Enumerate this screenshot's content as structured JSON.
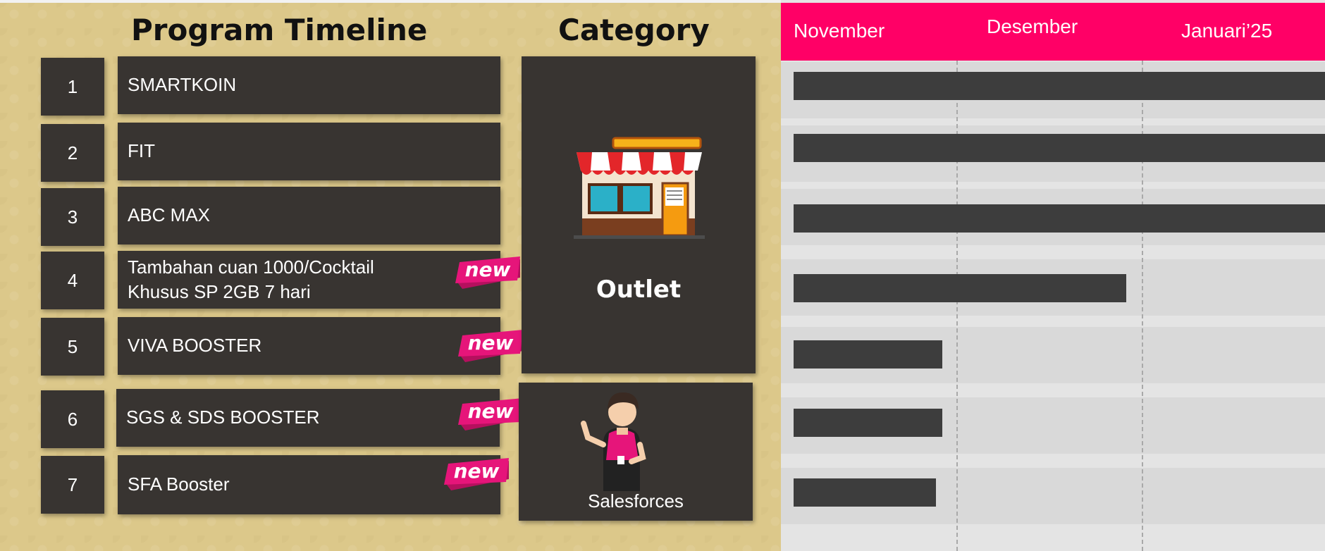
{
  "headings": {
    "program": "Program Timeline",
    "category": "Category"
  },
  "programs": [
    {
      "no": "1",
      "name": "SMARTKOIN",
      "is_new": false
    },
    {
      "no": "2",
      "name": "FIT",
      "is_new": false
    },
    {
      "no": "3",
      "name": "ABC MAX",
      "is_new": false
    },
    {
      "no": "4",
      "name": "Tambahan cuan 1000/Cocktail\nKhusus SP 2GB 7 hari",
      "is_new": true
    },
    {
      "no": "5",
      "name": "VIVA BOOSTER",
      "is_new": true
    },
    {
      "no": "6",
      "name": "SGS & SDS BOOSTER",
      "is_new": true
    },
    {
      "no": "7",
      "name": "SFA Booster",
      "is_new": true
    }
  ],
  "badge_text": "new",
  "categories": {
    "outlet": "Outlet",
    "salesforces": "Salesforces"
  },
  "months": [
    "November",
    "Desember",
    "Januari’25"
  ],
  "colors": {
    "header": "#ff0066",
    "bar": "#3d3d3d",
    "box": "#383431",
    "panel": "#dcc88a",
    "badge": "#e6157a"
  },
  "icons": [
    "shop-icon",
    "salesperson-icon"
  ]
}
